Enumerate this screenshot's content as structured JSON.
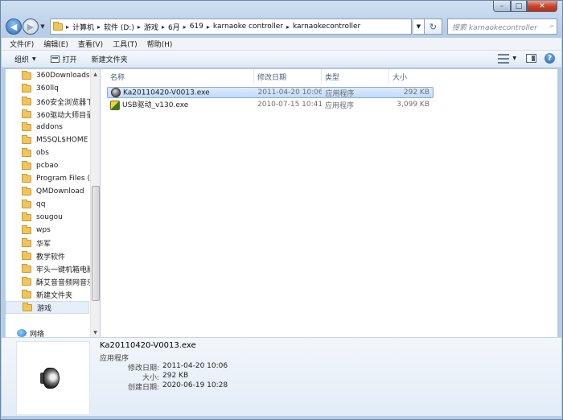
{
  "window": {
    "caption_minimize": "–",
    "caption_maximize": "□",
    "caption_close": "✕",
    "accent": "#2a6bc2"
  },
  "address": {
    "breadcrumbs": [
      "计算机",
      "软件 (D:)",
      "游戏",
      "6月",
      "619",
      "karnaoke controller",
      "karnaokecontroller"
    ],
    "search_placeholder": "搜索 karnaokecontroller"
  },
  "menu": [
    "文件(F)",
    "编辑(E)",
    "查看(V)",
    "工具(T)",
    "帮助(H)"
  ],
  "toolbar": {
    "organize": "组织",
    "open": "打开",
    "new_folder": "新建文件夹"
  },
  "nav": {
    "folders": [
      "360Downloads",
      "360llq",
      "360安全浏览器下",
      "360驱动大师目录",
      "addons",
      "MSSQL$HOME",
      "obs",
      "pcbao",
      "Program Files (",
      "QMDownload",
      "qq",
      "sougou",
      "wps",
      "华军",
      "教学软件",
      "牢头一键机箱电脑",
      "酥艾音音频网音乐",
      "新建文件夹",
      "游戏"
    ],
    "selected": "游戏",
    "network": "网络"
  },
  "columns": {
    "name": "名称",
    "modified": "修改日期",
    "type": "类型",
    "size": "大小"
  },
  "files": [
    {
      "name": "Ka20110420-V0013.exe",
      "modified": "2011-04-20 10:06",
      "type": "应用程序",
      "size": "292 KB",
      "icon": "speaker-exe-icon",
      "selected": true
    },
    {
      "name": "USB驱动_v130.exe",
      "modified": "2010-07-15 10:41",
      "type": "应用程序",
      "size": "3,099 KB",
      "icon": "usb-installer-icon",
      "selected": false
    }
  ],
  "details": {
    "name": "Ka20110420-V0013.exe",
    "type": "应用程序",
    "modified_label": "修改日期:",
    "modified": "2011-04-20 10:06",
    "size_label": "大小:",
    "size": "292 KB",
    "created_label": "创建日期:",
    "created": "2020-06-19 10:28"
  }
}
